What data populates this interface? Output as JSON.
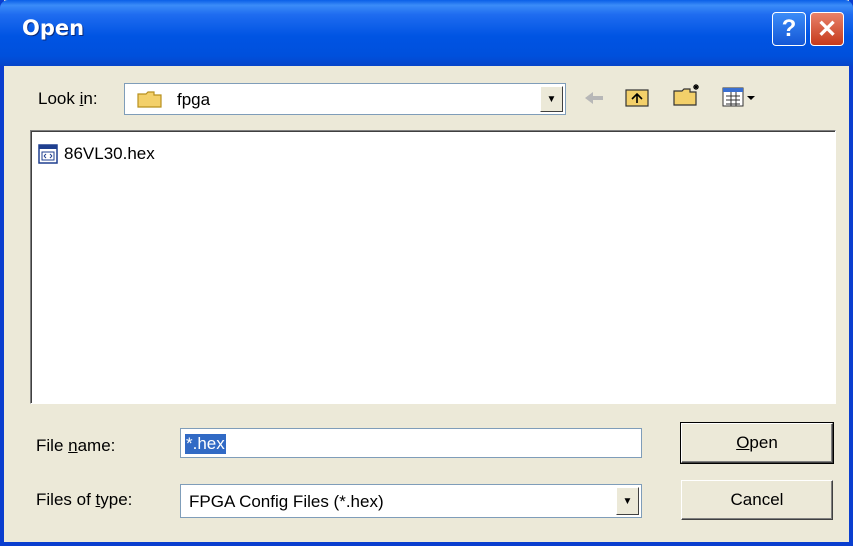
{
  "window": {
    "title": "Open"
  },
  "look_in": {
    "label_pre": "Look ",
    "label_accel": "i",
    "label_post": "n:",
    "value": "fpga"
  },
  "toolbar": {
    "back_icon": "back-arrow-icon",
    "up_icon": "up-folder-icon",
    "new_icon": "new-folder-icon",
    "view_icon": "view-menu-icon"
  },
  "files": [
    {
      "name": "86VL30.hex",
      "icon": "hex-file-icon"
    }
  ],
  "file_name": {
    "label_pre": "File ",
    "label_accel": "n",
    "label_post": "ame:",
    "value": "*.hex"
  },
  "file_type": {
    "label_pre": "Files of ",
    "label_accel": "t",
    "label_post": "ype:",
    "value": "FPGA Config Files (*.hex)"
  },
  "buttons": {
    "open_accel": "O",
    "open_rest": "pen",
    "cancel": "Cancel"
  }
}
